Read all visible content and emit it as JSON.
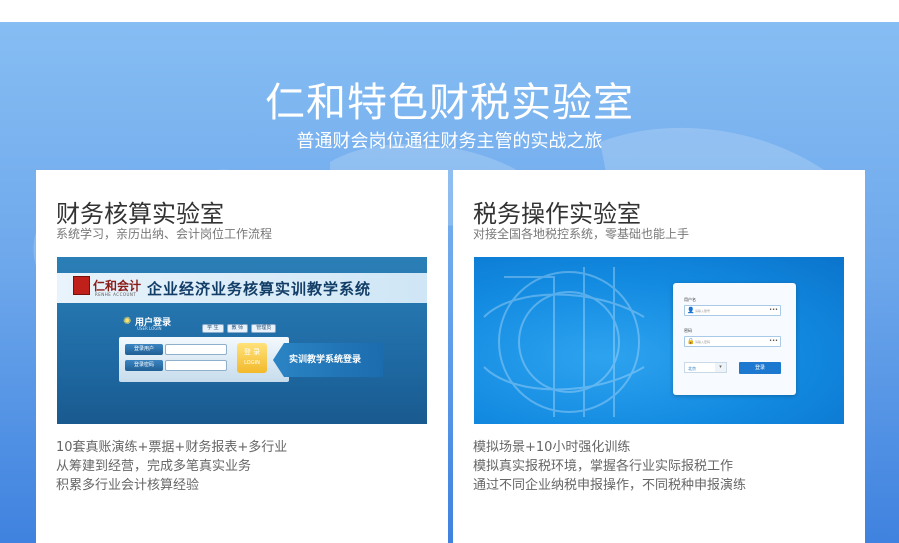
{
  "hero": {
    "title": "仁和特色财税实验室",
    "subtitle": "普通财会岗位通往财务主管的实战之旅"
  },
  "cards": [
    {
      "title": "财务核算实验室",
      "subtitle": "系统学习，亲历出纳、会计岗位工作流程",
      "lines": [
        "10套真账演练+票据+财务报表+多行业",
        "从筹建到经营，完成多笔真实业务",
        "积累多行业会计核算经验"
      ],
      "screenshot": {
        "brand": "仁和会计",
        "brand_sub": "RENHE ACCOUNT",
        "system_title": "企业经济业务核算实训教学系统",
        "login_header": "用户登录",
        "login_header_sub": "USER LOGIN",
        "roles": [
          "学 生",
          "教 师",
          "管理员"
        ],
        "username_label": "登录用户",
        "password_label": "登录密码",
        "login_button": "登 录",
        "login_button_sub": "LOGIN",
        "banner_text": "实训教学系统登录"
      }
    },
    {
      "title": "税务操作实验室",
      "subtitle": "对接全国各地税控系统，零基础也能上手",
      "lines": [
        "模拟场景+10小时强化训练",
        "模拟真实报税环境，掌握各行业实际报税工作",
        "通过不同企业纳税申报操作，不同税种申报演练"
      ],
      "screenshot": {
        "username_label": "用户名",
        "username_placeholder": "请输入账号",
        "password_label": "密码",
        "password_placeholder": "请输入密码",
        "select_value": "北京",
        "login_button": "登录"
      }
    }
  ],
  "colors": {
    "hero_top": "#86bdf3",
    "hero_bottom": "#3f82df",
    "card_bg": "#ffffff",
    "title_text": "#333333"
  }
}
